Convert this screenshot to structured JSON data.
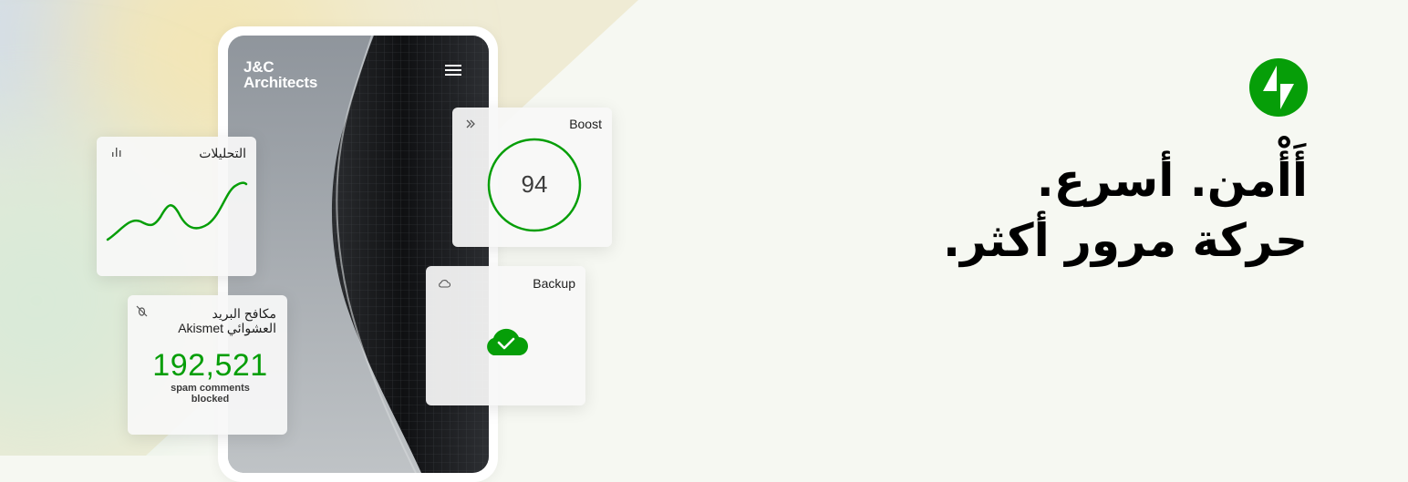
{
  "colors": {
    "accent": "#069e08",
    "background": "#f6f8f2"
  },
  "phone": {
    "brand_line1": "J&C",
    "brand_line2": "Architects",
    "menu_icon": "hamburger-menu-icon"
  },
  "analytics": {
    "title": "التحليلات",
    "icon": "bar-chart-icon"
  },
  "akismet": {
    "title_line1": "مكافح البريد",
    "title_line2": "العشوائي Akismet",
    "icon": "bug-shield-icon",
    "count": "192,521",
    "caption_line1": "spam comments",
    "caption_line2": "blocked"
  },
  "boost": {
    "title": "Boost",
    "icon": "double-chevron-icon",
    "score": "94",
    "score_value": 94
  },
  "backup": {
    "title": "Backup",
    "icon": "cloud-icon",
    "status_icon": "cloud-check-icon"
  },
  "hero": {
    "logo_icon": "jetpack-logo-icon",
    "line1": "أَأْمن. أسرع.",
    "line2": "حركة مرور أكثر."
  }
}
